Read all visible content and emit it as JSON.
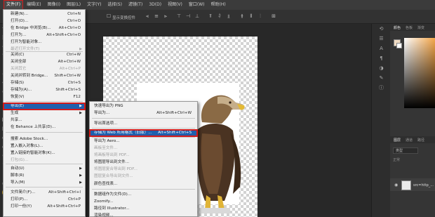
{
  "menubar": {
    "items": [
      "文件(F)",
      "编辑(E)",
      "图像(I)",
      "图层(L)",
      "文字(Y)",
      "选择(S)",
      "滤镜(T)",
      "3D(D)",
      "视图(V)",
      "窗口(W)",
      "帮助(H)"
    ]
  },
  "options": {
    "label": "显示变换控件"
  },
  "file_menu": {
    "items": [
      {
        "label": "新建(N)...",
        "shortcut": "Ctrl+N"
      },
      {
        "label": "打开(O)...",
        "shortcut": "Ctrl+O"
      },
      {
        "label": "在 Bridge 中浏览(B)...",
        "shortcut": "Alt+Ctrl+O"
      },
      {
        "label": "打开为...",
        "shortcut": "Alt+Shift+Ctrl+O"
      },
      {
        "label": "打开为智能对象...",
        "shortcut": ""
      },
      {
        "label": "最近打开文件(T)",
        "shortcut": ""
      },
      {
        "label": "关闭(C)",
        "shortcut": "Ctrl+W"
      },
      {
        "label": "关闭全部",
        "shortcut": "Alt+Ctrl+W"
      },
      {
        "label": "关闭其它",
        "shortcut": "Alt+Ctrl+P"
      },
      {
        "label": "关闭并转到 Bridge...",
        "shortcut": "Shift+Ctrl+W"
      },
      {
        "label": "存储(S)",
        "shortcut": "Ctrl+S"
      },
      {
        "label": "存储为(A)...",
        "shortcut": "Shift+Ctrl+S"
      },
      {
        "label": "恢复(V)",
        "shortcut": "F12"
      },
      {
        "label": "导出(E)",
        "shortcut": ""
      },
      {
        "label": "生成",
        "shortcut": ""
      },
      {
        "label": "共享...",
        "shortcut": ""
      },
      {
        "label": "在 Behance 上共享(D)...",
        "shortcut": ""
      },
      {
        "label": "搜索 Adobe Stock...",
        "shortcut": ""
      },
      {
        "label": "置入嵌入对象(L)...",
        "shortcut": ""
      },
      {
        "label": "置入链接的智能对象(K)...",
        "shortcut": ""
      },
      {
        "label": "打包(G)...",
        "shortcut": ""
      },
      {
        "label": "自动(U)",
        "shortcut": ""
      },
      {
        "label": "脚本(R)",
        "shortcut": ""
      },
      {
        "label": "导入(M)",
        "shortcut": ""
      },
      {
        "label": "文件简介(F)...",
        "shortcut": "Alt+Shift+Ctrl+I"
      },
      {
        "label": "打印(P)...",
        "shortcut": "Ctrl+P"
      },
      {
        "label": "打印一份(Y)",
        "shortcut": "Alt+Shift+Ctrl+P"
      }
    ]
  },
  "export_menu": {
    "items": [
      {
        "label": "快速导出为 PNG",
        "shortcut": ""
      },
      {
        "label": "导出为...",
        "shortcut": "Alt+Shift+Ctrl+W"
      },
      {
        "label": "导出首选项...",
        "shortcut": ""
      },
      {
        "label": "存储为 Web 所用格式（旧版）...",
        "shortcut": "Alt+Shift+Ctrl+S"
      },
      {
        "label": "导出为 Aero...",
        "shortcut": ""
      },
      {
        "label": "画板至文件...",
        "shortcut": ""
      },
      {
        "label": "将画板导出到 PDF...",
        "shortcut": ""
      },
      {
        "label": "将图层导出到文件...",
        "shortcut": ""
      },
      {
        "label": "将图层复合导出到 PDF...",
        "shortcut": ""
      },
      {
        "label": "图层复合导出到文件...",
        "shortcut": ""
      },
      {
        "label": "颜色查找表...",
        "shortcut": ""
      },
      {
        "label": "数据组作为文件(D)...",
        "shortcut": ""
      },
      {
        "label": "Zoomify...",
        "shortcut": ""
      },
      {
        "label": "路径到 Illustrator...",
        "shortcut": ""
      },
      {
        "label": "渲染视频...",
        "shortcut": ""
      }
    ]
  },
  "right_panel": {
    "tabs_top": [
      "颜色",
      "色板",
      "渐变"
    ],
    "tabs_layers": [
      "图层",
      "通道",
      "路径"
    ],
    "layer_filter": "类型",
    "layer_mode": "正常",
    "layer_name": "src=http_..."
  },
  "colors": {
    "highlight": "#1f5fad",
    "annotation": "#d21b1b",
    "foreground": "#f1dcc4"
  }
}
